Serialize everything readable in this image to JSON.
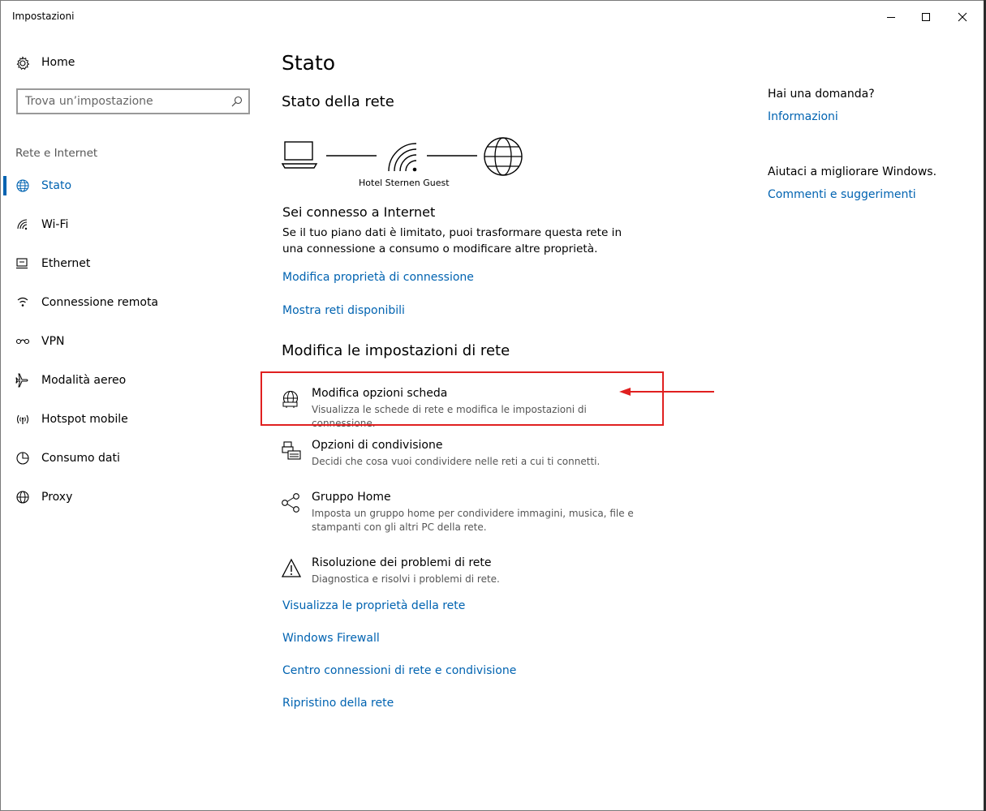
{
  "window": {
    "title": "Impostazioni"
  },
  "sidebar": {
    "home_label": "Home",
    "search_placeholder": "Trova un’impostazione",
    "section_label": "Rete e Internet",
    "items": [
      {
        "label": "Stato",
        "icon": "globe-icon"
      },
      {
        "label": "Wi-Fi",
        "icon": "wifi-icon"
      },
      {
        "label": "Ethernet",
        "icon": "ethernet-icon"
      },
      {
        "label": "Connessione remota",
        "icon": "dialup-icon"
      },
      {
        "label": "VPN",
        "icon": "vpn-icon"
      },
      {
        "label": "Modalità aereo",
        "icon": "airplane-icon"
      },
      {
        "label": "Hotspot mobile",
        "icon": "hotspot-icon"
      },
      {
        "label": "Consumo dati",
        "icon": "data-usage-icon"
      },
      {
        "label": "Proxy",
        "icon": "proxy-globe-icon"
      }
    ]
  },
  "main": {
    "title": "Stato",
    "network_status_heading": "Stato della rete",
    "network_name": "Hotel Sternen Guest",
    "connected_heading": "Sei connesso a Internet",
    "connected_desc": "Se il tuo piano dati è limitato, puoi trasformare questa rete in una connessione a consumo o modificare altre proprietà.",
    "link_change_props": "Modifica proprietà di connessione",
    "link_show_networks": "Mostra reti disponibili",
    "change_settings_heading": "Modifica le impostazioni di rete",
    "options": [
      {
        "title": "Modifica opzioni scheda",
        "desc": "Visualizza le schede di rete e modifica le impostazioni di connessione."
      },
      {
        "title": "Opzioni di condivisione",
        "desc": "Decidi che cosa vuoi condividere nelle reti a cui ti connetti."
      },
      {
        "title": "Gruppo Home",
        "desc": "Imposta un gruppo home per condividere immagini, musica, file e stampanti con gli altri PC della rete."
      },
      {
        "title": "Risoluzione dei problemi di rete",
        "desc": "Diagnostica e risolvi i problemi di rete."
      }
    ],
    "bottom_links": [
      "Visualizza le proprietà della rete",
      "Windows Firewall",
      "Centro connessioni di rete e condivisione",
      "Ripristino della rete"
    ]
  },
  "aside": {
    "question": "Hai una domanda?",
    "info_link": "Informazioni",
    "improve_text": "Aiutaci a migliorare Windows.",
    "feedback_link": "Commenti e suggerimenti"
  },
  "colors": {
    "accent": "#0063b1",
    "annotation": "#e02020"
  }
}
